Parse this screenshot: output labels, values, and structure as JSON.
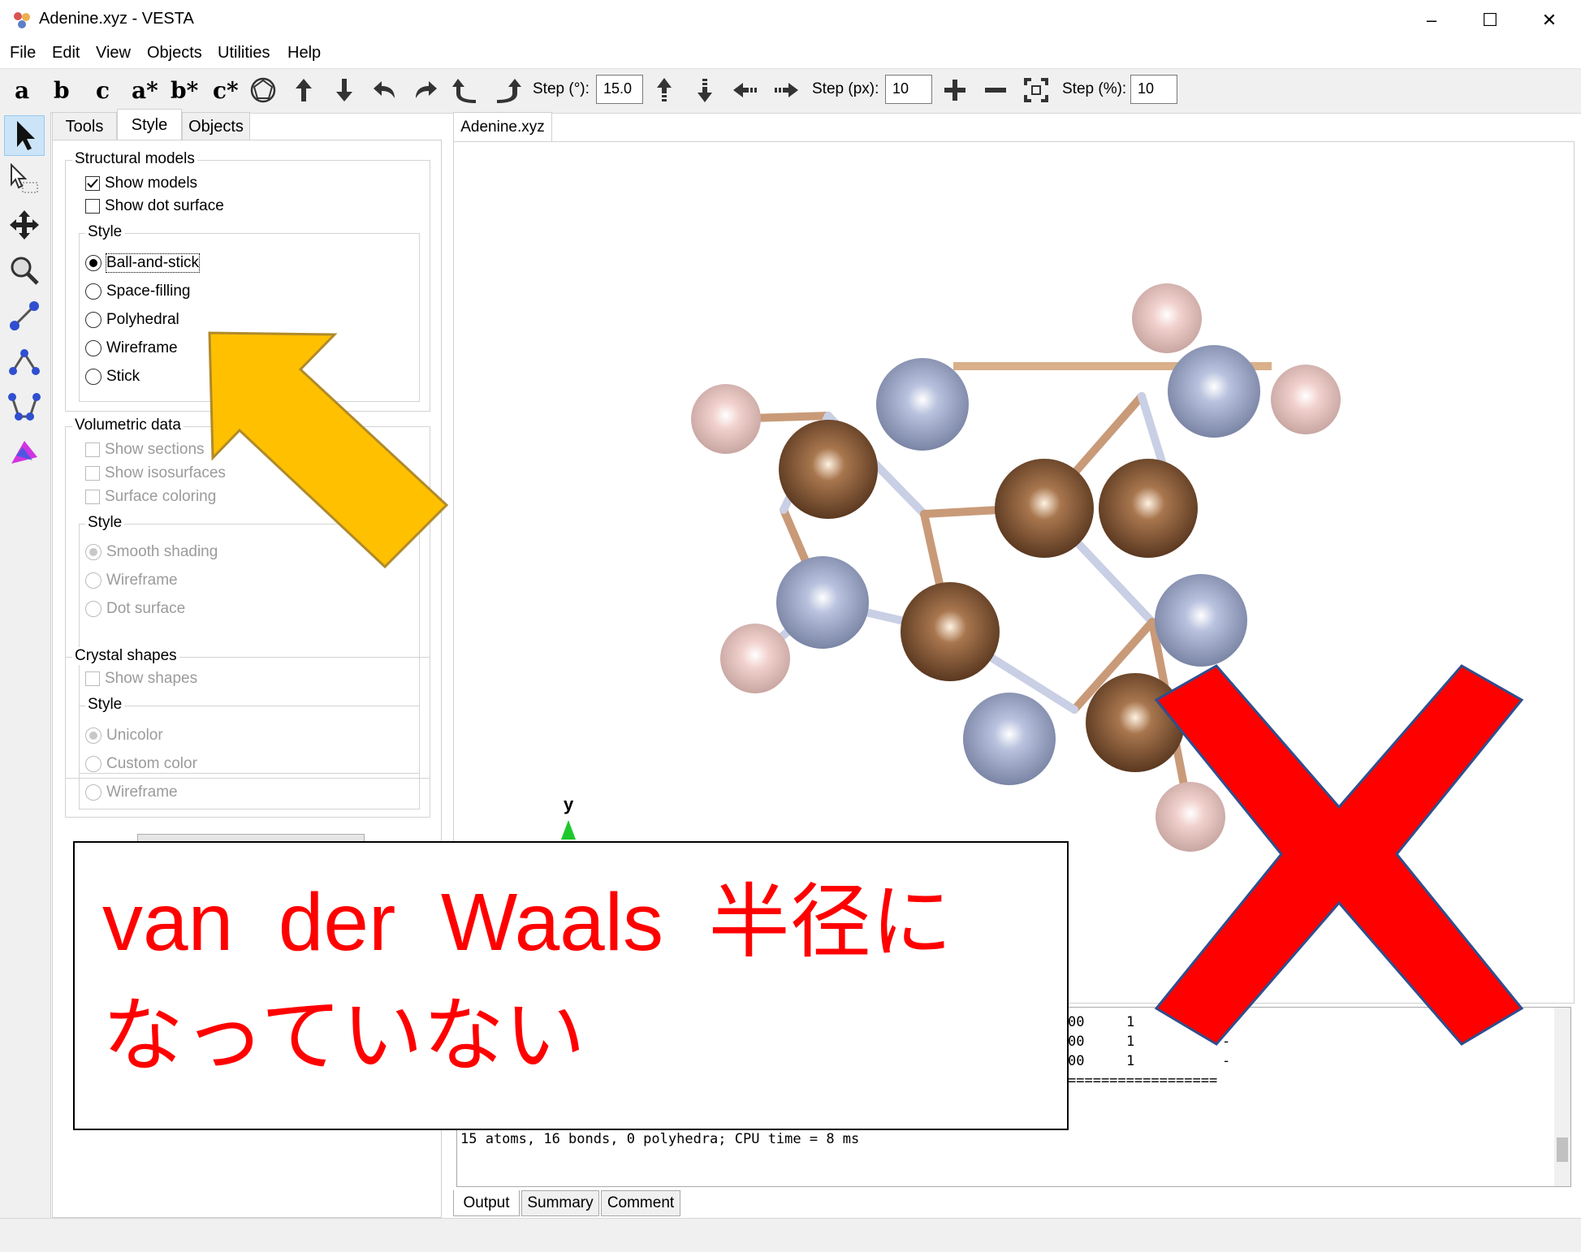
{
  "window": {
    "title": "Adenine.xyz - VESTA",
    "controls": [
      "–",
      "☐",
      "✕"
    ]
  },
  "menu": [
    "File",
    "Edit",
    "View",
    "Objects",
    "Utilities",
    "Help"
  ],
  "toolbar": {
    "axes": [
      "a",
      "b",
      "c",
      "a*",
      "b*",
      "c*"
    ],
    "step_deg_label": "Step (°):",
    "step_deg_value": "15.0",
    "step_px_label": "Step (px):",
    "step_px_value": "10",
    "step_pct_label": "Step (%):",
    "step_pct_value": "10"
  },
  "panel_tabs": [
    "Tools",
    "Style",
    "Objects"
  ],
  "structural_models": {
    "title": "Structural models",
    "show_models": "Show models",
    "show_models_checked": true,
    "show_dot_surface": "Show dot surface",
    "style_title": "Style",
    "styles": [
      "Ball-and-stick",
      "Space-filling",
      "Polyhedral",
      "Wireframe",
      "Stick"
    ],
    "selected_style": "Ball-and-stick"
  },
  "volumetric_data": {
    "title": "Volumetric data",
    "options": [
      "Show sections",
      "Show isosurfaces",
      "Surface coloring"
    ],
    "style_title": "Style",
    "styles": [
      "Smooth shading",
      "Wireframe",
      "Dot surface"
    ],
    "selected_style": "Smooth shading"
  },
  "crystal_shapes": {
    "title": "Crystal shapes",
    "show_shapes": "Show shapes",
    "style_title": "Style",
    "styles": [
      "Unicolor",
      "Custom color",
      "Wireframe"
    ],
    "selected_style": "Unicolor"
  },
  "document_tab": "Adenine.xyz",
  "axis_label": "y",
  "console": {
    "rows": [
      [
        "00",
        "1",
        "-"
      ],
      [
        "00",
        "1",
        "-"
      ],
      [
        "00",
        "1",
        "-"
      ]
    ],
    "separator": "==================",
    "summary": "15 atoms, 16 bonds, 0 polyhedra; CPU time = 8 ms"
  },
  "bottom_tabs": [
    "Output",
    "Summary",
    "Comment"
  ],
  "annotation": {
    "line1": "van  der  Waals  半径に",
    "line2": "なっていない",
    "arrow_color": "#FFC000",
    "cross_color": "#FF0000"
  },
  "colors": {
    "carbon": "#8B5A3C",
    "nitrogen": "#AEB8D8",
    "hydrogen": "#F0CFCC"
  }
}
